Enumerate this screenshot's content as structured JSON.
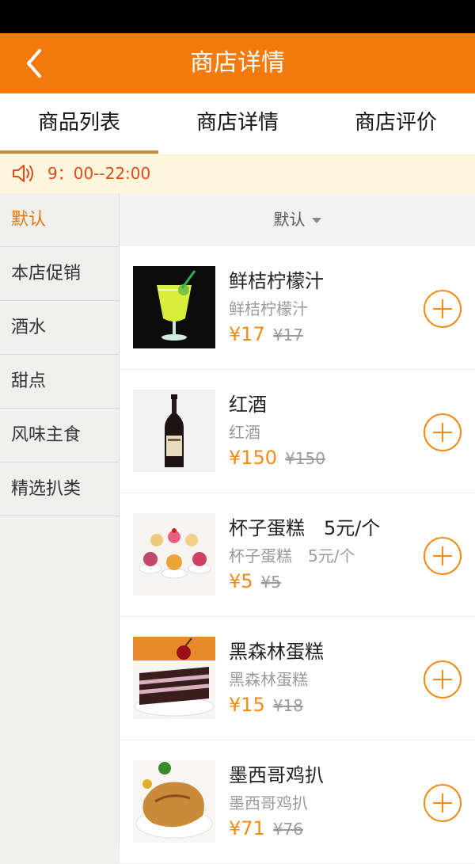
{
  "app_bar": {
    "title": "商店详情"
  },
  "tabs": [
    {
      "label": "商品列表",
      "active": true
    },
    {
      "label": "商店详情",
      "active": false
    },
    {
      "label": "商店评价",
      "active": false
    }
  ],
  "notice": {
    "icon": "speaker-icon",
    "text": "9：00--22:00"
  },
  "sidebar": {
    "items": [
      {
        "label": "默认",
        "active": true
      },
      {
        "label": "本店促销"
      },
      {
        "label": "酒水"
      },
      {
        "label": "甜点"
      },
      {
        "label": "风味主食"
      },
      {
        "label": "精选扒类"
      }
    ]
  },
  "sort": {
    "label": "默认"
  },
  "products": [
    {
      "name": "鲜桔柠檬汁",
      "sub": "鲜桔柠檬汁",
      "price": "¥17",
      "old_price": "¥17"
    },
    {
      "name": "红酒",
      "sub": "红酒",
      "price": "¥150",
      "old_price": "¥150"
    },
    {
      "name": "杯子蛋糕　5元/个",
      "sub": "杯子蛋糕　5元/个",
      "price": "¥5",
      "old_price": "¥5"
    },
    {
      "name": "黑森林蛋糕",
      "sub": "黑森林蛋糕",
      "price": "¥15",
      "old_price": "¥18"
    },
    {
      "name": "墨西哥鸡扒",
      "sub": "墨西哥鸡扒",
      "price": "¥71",
      "old_price": "¥76"
    }
  ],
  "colors": {
    "brand": "#f57a0e",
    "price": "#f08c14",
    "notice_text": "#e24a1a",
    "tab_indicator": "#c98a3a"
  }
}
